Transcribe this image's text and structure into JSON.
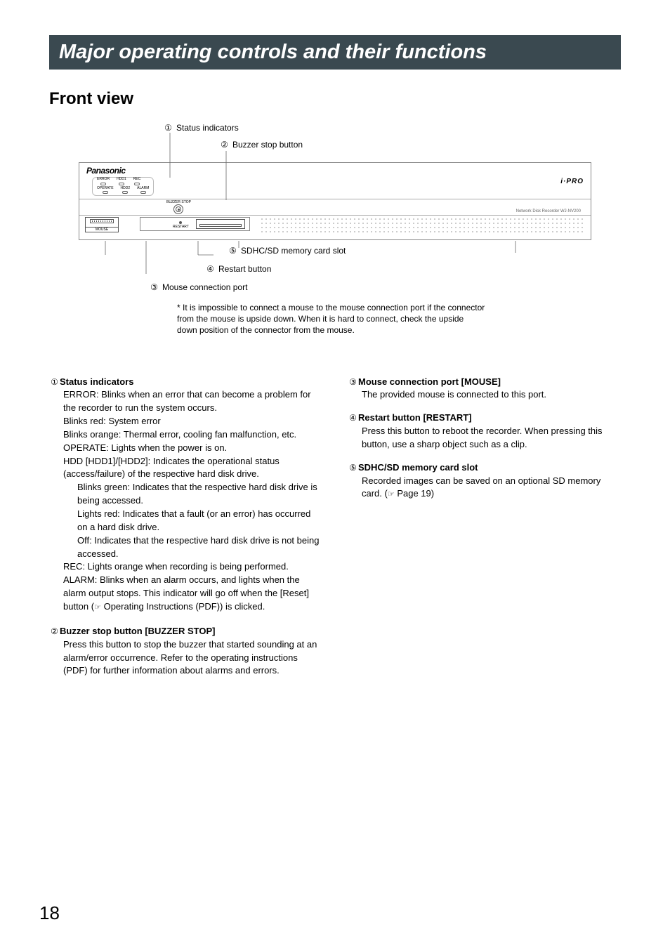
{
  "title_band": "Major operating controls and their functions",
  "section_heading": "Front view",
  "page_number": "18",
  "diagram": {
    "callouts": {
      "1": "Status indicators",
      "2": "Buzzer stop button",
      "3": "Mouse connection port",
      "4": "Restart button",
      "5": "SDHC/SD memory card slot"
    },
    "panel": {
      "brand_left": "Panasonic",
      "brand_right": "i·PRO",
      "model_name": "Network Disk Recorder WJ-NV200",
      "leds_row1": [
        "ERROR",
        "HDD1",
        "REC"
      ],
      "leds_row2": [
        "OPERATE",
        "HDD2",
        "ALARM"
      ],
      "buzzer_label": "BUZZER STOP",
      "mouse_label": "MOUSE",
      "restart_label": "RESTART"
    },
    "note": "* It is impossible to connect a mouse to the mouse connection port if the connector from the mouse is upside down. When it is hard to connect, check the upside down position of the connector from the mouse."
  },
  "descriptions": {
    "item1": {
      "head": "Status indicators",
      "error_label": "ERROR:",
      "error_text": " Blinks when an error that can become a problem for the recorder to run the system occurs.",
      "blinks_red_label": "Blinks red:",
      "blinks_red_text": " System error",
      "blinks_orange_label": "Blinks orange:",
      "blinks_orange_text": " Thermal error, cooling fan malfunction, etc.",
      "operate_label": "OPERATE:",
      "operate_text": " Lights when the power is on.",
      "hdd_label": "HDD [HDD1]/[HDD2]:",
      "hdd_text": " Indicates the operational status (access/failure) of the respective hard disk drive.",
      "blinks_green_label": "Blinks green:",
      "blinks_green_text": " Indicates that the respective hard disk drive is being accessed.",
      "lights_red_label": "Lights red:",
      "lights_red_text": " Indicates that a fault (or an error) has occurred on a hard disk drive.",
      "off_label": "Off:",
      "off_text": " Indicates that the respective hard disk drive is not being accessed.",
      "rec_label": "REC:",
      "rec_text": " Lights orange when recording is being performed.",
      "alarm_label": "ALARM:",
      "alarm_text_a": " Blinks when an alarm occurs, and lights when the alarm output stops. This indicator will go off when the [Reset] button (",
      "alarm_text_b": " Operating Instructions (PDF)) is clicked."
    },
    "item2": {
      "head": "Buzzer stop button [BUZZER STOP]",
      "text": "Press this button to stop the buzzer that started sounding at an alarm/error occurrence. Refer to the operating instructions (PDF) for further information about alarms and errors."
    },
    "item3": {
      "head": "Mouse connection port [MOUSE]",
      "text": "The provided mouse is connected to this port."
    },
    "item4": {
      "head": "Restart button [RESTART]",
      "text": "Press this button to reboot the recorder. When pressing this button, use a sharp object such as a clip."
    },
    "item5": {
      "head": "SDHC/SD memory card slot",
      "text_a": "Recorded images can be saved on an optional SD memory card. (",
      "text_b": " Page 19)"
    }
  }
}
